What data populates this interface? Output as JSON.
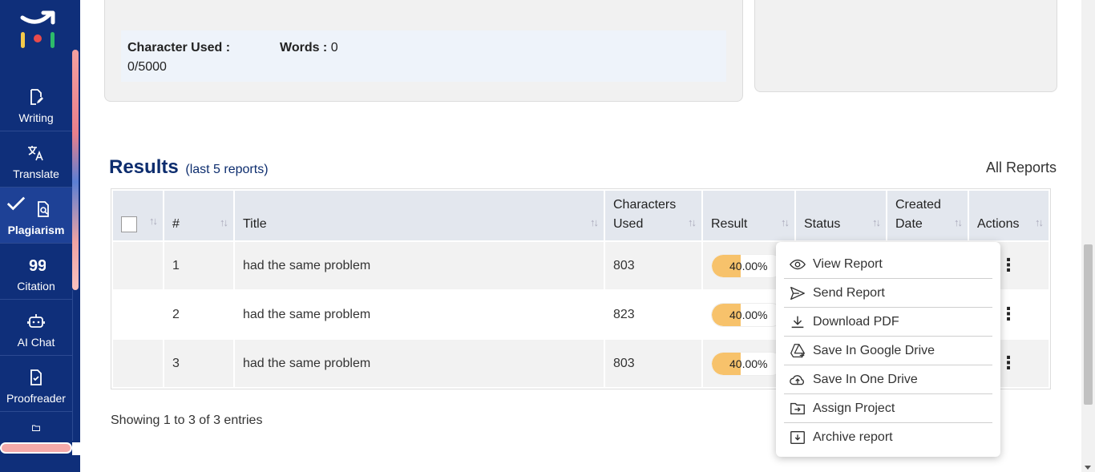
{
  "sidebar": {
    "items": [
      {
        "label": "Writing",
        "icon": "writing-icon"
      },
      {
        "label": "Translate",
        "icon": "translate-icon"
      },
      {
        "label": "Plagiarism",
        "icon": "plagiarism-icon",
        "active": true
      },
      {
        "label": "Citation",
        "icon": "citation-icon"
      },
      {
        "label": "AI Chat",
        "icon": "ai-chat-icon"
      },
      {
        "label": "Proofreader",
        "icon": "proofreader-icon"
      },
      {
        "label": "",
        "icon": "folder-icon"
      }
    ]
  },
  "counts": {
    "char_label": "Character Used :",
    "char_value": "0/5000",
    "words_label": "Words :",
    "words_value": "0"
  },
  "results": {
    "title": "Results",
    "subtitle": "(last 5 reports)",
    "all_reports": "All Reports",
    "columns": [
      "#",
      "Title",
      "Characters Used",
      "Result",
      "Status",
      "Created Date",
      "Actions"
    ],
    "rows": [
      {
        "num": "1",
        "title": "had the same problem",
        "chars": "803",
        "result": "40.00%"
      },
      {
        "num": "2",
        "title": "had the same problem",
        "chars": "823",
        "result": "40.00%"
      },
      {
        "num": "3",
        "title": "had the same problem",
        "chars": "803",
        "result": "40.00%"
      }
    ],
    "showing": "Showing 1 to 3 of 3 entries"
  },
  "menu": {
    "items": [
      {
        "label": "View Report",
        "icon": "eye-icon"
      },
      {
        "label": "Send Report",
        "icon": "send-icon"
      },
      {
        "label": "Download PDF",
        "icon": "download-icon"
      },
      {
        "label": "Save In Google Drive",
        "icon": "google-drive-icon"
      },
      {
        "label": "Save In One Drive",
        "icon": "cloud-upload-icon"
      },
      {
        "label": "Assign Project",
        "icon": "assign-folder-icon"
      },
      {
        "label": "Archive report",
        "icon": "archive-icon"
      }
    ]
  },
  "colors": {
    "sidebar": "#0f2f7a",
    "accent_pill": "#f7c26b",
    "title": "#0d2d6e"
  }
}
